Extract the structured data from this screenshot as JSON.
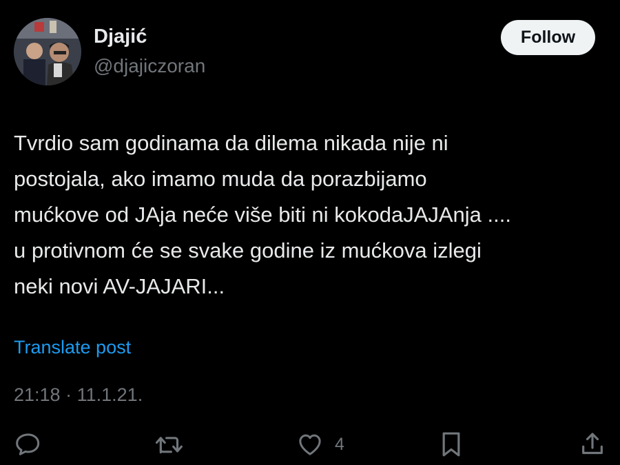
{
  "author": {
    "display_name": "Djajić",
    "handle": "@djajiczoran",
    "avatar_icon": "profile-photo"
  },
  "follow_label": "Follow",
  "tweet": {
    "lines": [
      "Tvrdio sam godinama da dilema nikada nije ni",
      "postojala, ako imamo muda da porazbijamo",
      "mućkove od JAja neće više biti ni kokodaJAJAnja ....",
      "u protivnom će se svake godine iz mućkova izlegi",
      "neki novi AV-JAJARI..."
    ]
  },
  "translate_label": "Translate post",
  "meta": {
    "time": "21:18",
    "separator": "·",
    "date": "11.1.21."
  },
  "actions": {
    "reply_icon": "reply-icon",
    "retweet_icon": "retweet-icon",
    "like_icon": "heart-icon",
    "like_count": "4",
    "bookmark_icon": "bookmark-icon",
    "share_icon": "share-icon"
  },
  "colors": {
    "background": "#000000",
    "text": "#e7e9ea",
    "secondary": "#71767b",
    "link": "#1d9bf0",
    "button_bg": "#eff3f4"
  }
}
